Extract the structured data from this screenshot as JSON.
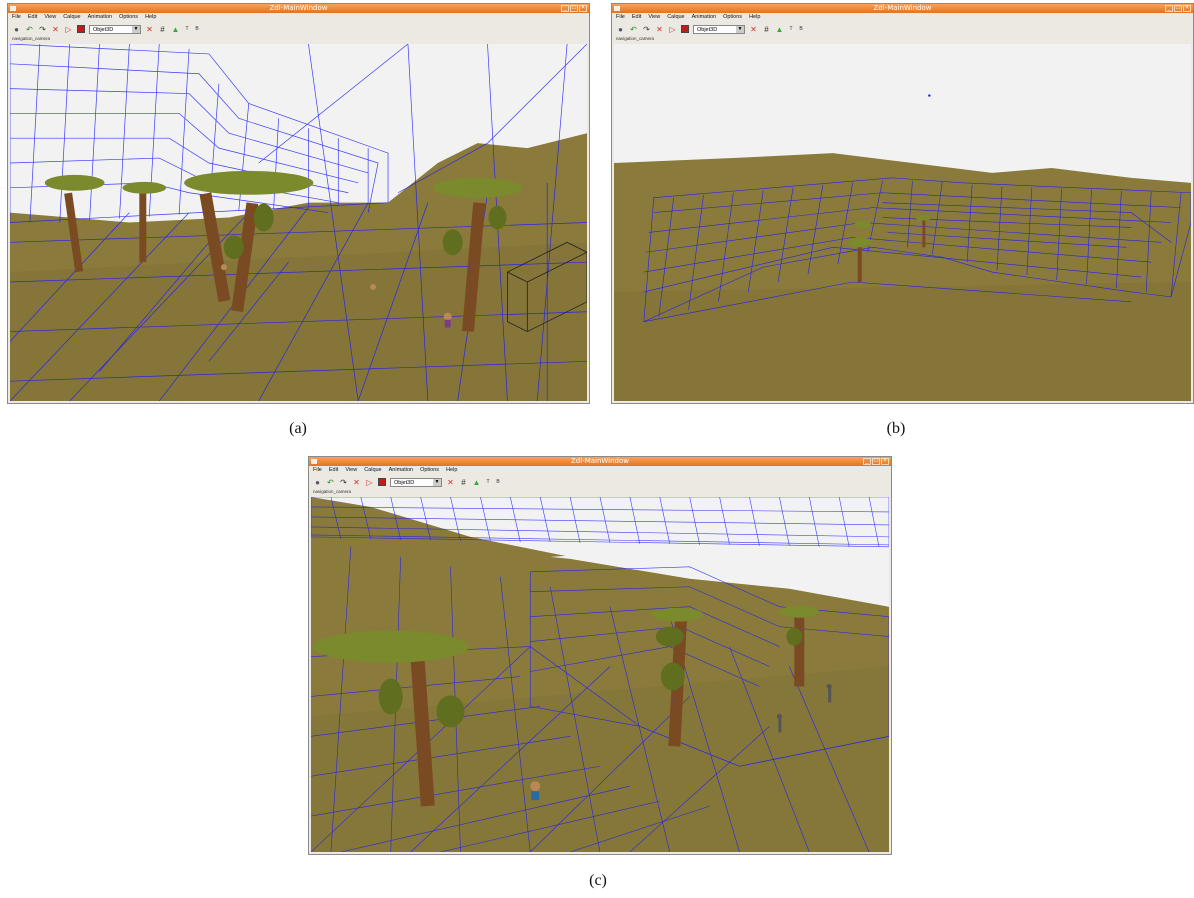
{
  "window": {
    "title": "Zdl-MainWindow",
    "menu": [
      "File",
      "Edit",
      "View",
      "Calque",
      "Animation",
      "Options",
      "Help"
    ],
    "object_combo": "Objet3D",
    "toolbar_text": [
      "T",
      "B"
    ],
    "viewport_label": "navigation_camera"
  },
  "captions": {
    "a": "(a)",
    "b": "(b)",
    "c": "(c)"
  },
  "colors": {
    "wire": "#1a1aff",
    "ground": "#8a7a3c",
    "sky": "#f3f3f3",
    "titlebar": "#e3731f",
    "trunk": "#7a4a22",
    "canopy": "#7c8a2e"
  }
}
